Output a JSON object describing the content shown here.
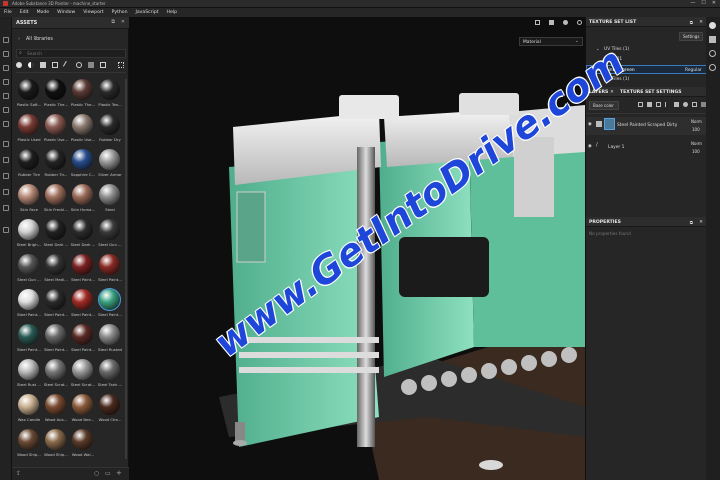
{
  "window": {
    "title": "Adobe Substance 3D Painter - machine_starter",
    "minimize": "—",
    "maximize": "☐",
    "close": "✕"
  },
  "menu": [
    "File",
    "Edit",
    "Mode",
    "Window",
    "Viewport",
    "Python",
    "JavaScript",
    "Help"
  ],
  "assets": {
    "title": "ASSETS",
    "breadcrumb": "All libraries",
    "search_placeholder": "Search",
    "materials": [
      {
        "label": "Plastic Soft...",
        "color": "#1a1a1a"
      },
      {
        "label": "Plastic The...",
        "color": "#101010"
      },
      {
        "label": "Plastic The...",
        "color": "#5a3a34"
      },
      {
        "label": "Plastic Tex...",
        "color": "#2a2a2a"
      },
      {
        "label": "Plastic Used",
        "color": "#7a3b33"
      },
      {
        "label": "Plastic Use...",
        "color": "#8a5a52"
      },
      {
        "label": "Plastic Use...",
        "color": "#8a7a70"
      },
      {
        "label": "Rubber Dry",
        "color": "#2a2a2a"
      },
      {
        "label": "Rubber Tire",
        "color": "#1e1e1e"
      },
      {
        "label": "Rubber Tir...",
        "color": "#242424"
      },
      {
        "label": "Sapphire C...",
        "color": "#284c8c"
      },
      {
        "label": "Silver Armor",
        "color": "#9a9a9a"
      },
      {
        "label": "Skin Face",
        "color": "#b88a78"
      },
      {
        "label": "Skin Freckl...",
        "color": "#a0705e"
      },
      {
        "label": "Skin Huma...",
        "color": "#9a6a58"
      },
      {
        "label": "Steel",
        "color": "#8e8e8e"
      },
      {
        "label": "Steel Brigh...",
        "color": "#d0d0d0"
      },
      {
        "label": "Steel Dark ...",
        "color": "#222"
      },
      {
        "label": "Steel Dark ...",
        "color": "#2c2c2c"
      },
      {
        "label": "Steel Gun ...",
        "color": "#3a3a3a"
      },
      {
        "label": "Steel Gun ...",
        "color": "#555"
      },
      {
        "label": "Steel Medi...",
        "color": "#333"
      },
      {
        "label": "Steel Paint...",
        "color": "#7a2020"
      },
      {
        "label": "Steel Paint...",
        "color": "#8a2a24"
      },
      {
        "label": "Steel Paint...",
        "color": "#ddd"
      },
      {
        "label": "Steel Paint...",
        "color": "#2a2a2a"
      },
      {
        "label": "Steel Paint...",
        "color": "#a02a24"
      },
      {
        "label": "Steel Paint...",
        "color": "#3aa080"
      },
      {
        "label": "Steel Paint...",
        "color": "#2a5a54"
      },
      {
        "label": "Steel Paint...",
        "color": "#6a6a6a"
      },
      {
        "label": "Steel Paint...",
        "color": "#5a2a24"
      },
      {
        "label": "Steel Rusted",
        "color": "#8a8a8a"
      },
      {
        "label": "Steel Rust ...",
        "color": "#bbb"
      },
      {
        "label": "Steel Scrat...",
        "color": "#777"
      },
      {
        "label": "Steel Scrat...",
        "color": "#999"
      },
      {
        "label": "Steel Tank ...",
        "color": "#6a6a6a"
      },
      {
        "label": "Wax Candle",
        "color": "#c8b090"
      },
      {
        "label": "Wood Aca...",
        "color": "#7a4a30"
      },
      {
        "label": "Wood Bee...",
        "color": "#8a5a3a"
      },
      {
        "label": "Wood Che...",
        "color": "#4a2a1e"
      },
      {
        "label": "Wood Ship...",
        "color": "#6a4a34"
      },
      {
        "label": "Wood Ship...",
        "color": "#8a6a4a"
      },
      {
        "label": "Wood Wal...",
        "color": "#5a3a28"
      }
    ],
    "selected_index": 27
  },
  "viewport": {
    "mode_select": "Material"
  },
  "texture_set_list": {
    "title": "TEXTURE SET LIST",
    "settings_label": "Settings",
    "items": [
      {
        "text": "UV Tiles (1)"
      },
      {
        "text": "1001"
      },
      {
        "text": "al_painted_green",
        "shader": "Regular"
      },
      {
        "text": "UV Tiles (1)"
      }
    ]
  },
  "layers": {
    "tab_layers": "LAYERS",
    "tab_settings": "TEXTURE SET SETTINGS",
    "channel_select": "Base color",
    "items": [
      {
        "name": "Steel Painted Scraped Dirty",
        "blend": "Norm",
        "opacity": "100"
      },
      {
        "name": "Layer 1",
        "blend": "Norm",
        "opacity": "100"
      }
    ]
  },
  "properties": {
    "title": "PROPERTIES",
    "empty_text": "No properties found"
  },
  "watermark": "www.GetIntoDrive.com"
}
